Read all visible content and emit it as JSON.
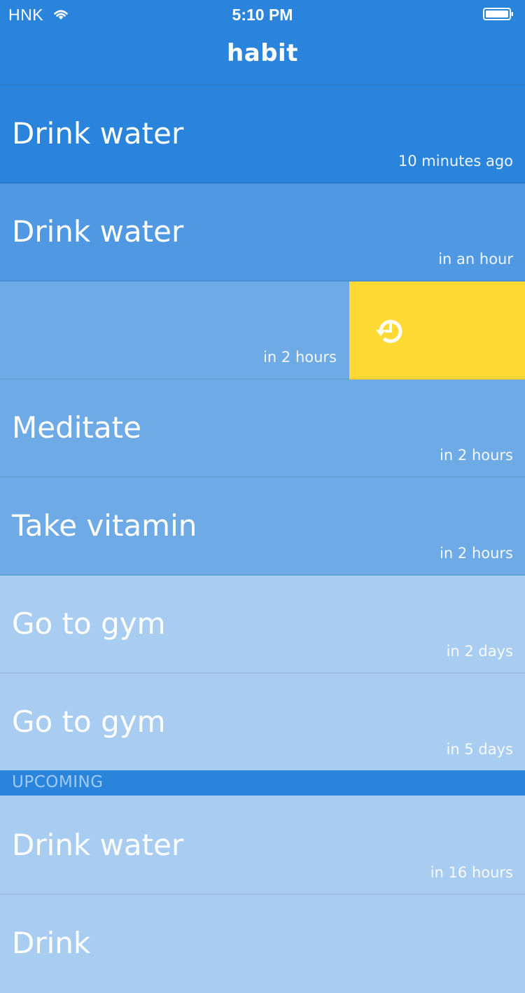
{
  "status_bar": {
    "carrier": "HNK",
    "time": "5:10 PM"
  },
  "nav": {
    "title": "habit"
  },
  "habits": [
    {
      "title": "Drink water",
      "time": "10 minutes ago"
    },
    {
      "title": "Drink water",
      "time": "in an hour"
    },
    {
      "title": "",
      "time": "in 2 hours",
      "swipe_action": "snooze"
    },
    {
      "title": "Meditate",
      "time": "in 2 hours"
    },
    {
      "title": "Take vitamin",
      "time": "in 2 hours"
    },
    {
      "title": "Go to gym",
      "time": "in 2 days"
    },
    {
      "title": "Go to gym",
      "time": "in 5 days"
    }
  ],
  "upcoming": {
    "label": "UPCOMING",
    "items": [
      {
        "title": "Drink water",
        "time": "in 16 hours"
      },
      {
        "title": "Drink"
      }
    ]
  },
  "colors": {
    "primary": "#2a84dc",
    "row_2": "#5098e2",
    "row_3": "#6daae6",
    "row_light": "#a9cdf1",
    "snooze": "#ffd934"
  }
}
